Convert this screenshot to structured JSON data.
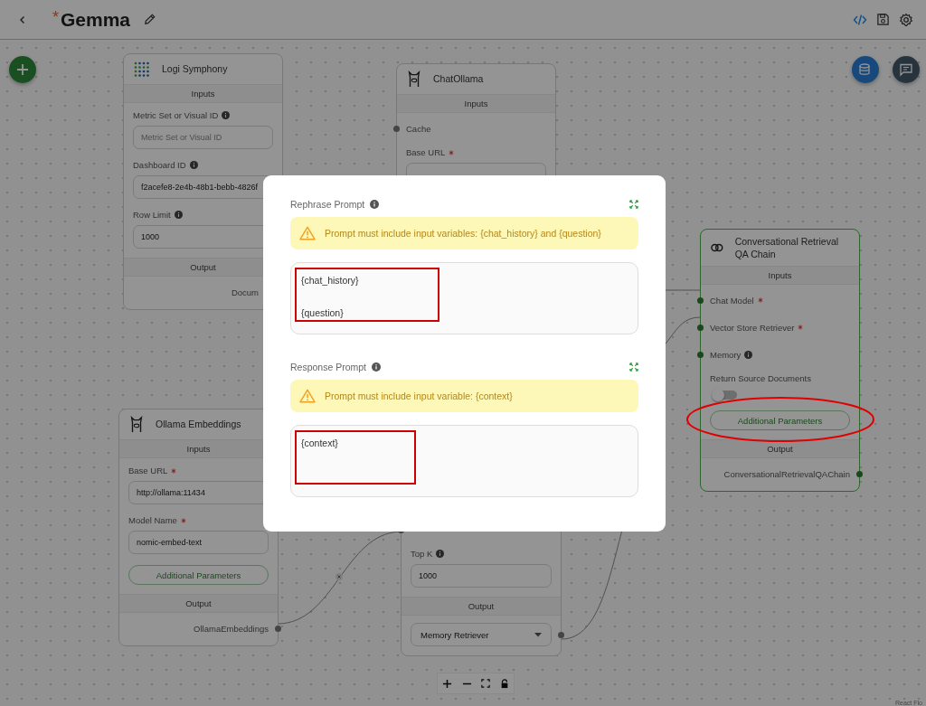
{
  "header": {
    "unsaved_mark": "*",
    "title": "Gemma"
  },
  "nodes": [
    {
      "title": "Logi Symphony",
      "selected": false,
      "inputs_label": "Inputs",
      "params": [
        {
          "kind": "field",
          "label": "Metric Set or Visual ID",
          "info": true,
          "placeholder": "Metric Set or Visual ID"
        },
        {
          "kind": "field",
          "label": "Dashboard ID",
          "info": true,
          "value": "f2acefe8-2e4b-48b1-bebb-4826f"
        },
        {
          "kind": "field",
          "label": "Row Limit",
          "info": true,
          "value": "1000"
        }
      ],
      "output_label": "Output",
      "outputs": [
        {
          "kind": "anchor",
          "label": "Docum"
        }
      ]
    },
    {
      "title": "ChatOllama",
      "selected": false,
      "inputs_label": "Inputs",
      "params": [
        {
          "kind": "anchor",
          "label": "Cache"
        },
        {
          "kind": "field",
          "label": "Base URL",
          "required": true
        }
      ]
    },
    {
      "title": "Conversational Retrieval QA Chain",
      "selected": true,
      "inputs_label": "Inputs",
      "params": [
        {
          "kind": "anchor",
          "label": "Chat Model",
          "required": true
        },
        {
          "kind": "anchor",
          "label": "Vector Store Retriever",
          "required": true
        },
        {
          "kind": "anchor",
          "label": "Memory",
          "info": true
        },
        {
          "kind": "toggle",
          "label": "Return Source Documents",
          "on": false
        },
        {
          "kind": "button",
          "label": "Additional Parameters",
          "circled": true
        }
      ],
      "output_label": "Output",
      "outputs": [
        {
          "kind": "anchor",
          "label": "ConversationalRetrievalQAChain"
        }
      ]
    },
    {
      "title": "Ollama Embeddings",
      "selected": false,
      "inputs_label": "Inputs",
      "params": [
        {
          "kind": "field",
          "label": "Base URL",
          "required": true,
          "value": "http://ollama:11434"
        },
        {
          "kind": "field",
          "label": "Model Name",
          "required": true,
          "value": "nomic-embed-text"
        },
        {
          "kind": "button",
          "label": "Additional Parameters"
        }
      ],
      "output_label": "Output",
      "outputs": [
        {
          "kind": "anchor",
          "label": "OllamaEmbeddings"
        }
      ]
    },
    {
      "selected": false,
      "params": [
        {
          "kind": "anchor"
        },
        {
          "kind": "field",
          "label": "Top K",
          "info": true,
          "value": "1000"
        }
      ],
      "output_label": "Output",
      "outputs": [
        {
          "kind": "select",
          "value": "Memory Retriever"
        }
      ]
    }
  ],
  "dialog": {
    "sections": [
      {
        "label": "Rephrase Prompt",
        "info": true,
        "warning": "Prompt must include input variables: {chat_history} and {question}",
        "text": "{chat_history}\n\n{question}",
        "highlighted": true
      },
      {
        "label": "Response Prompt",
        "info": true,
        "warning": "Prompt must include input variable: {context}",
        "text": "{context}",
        "highlighted": true
      }
    ]
  },
  "attribution": "React Flo"
}
